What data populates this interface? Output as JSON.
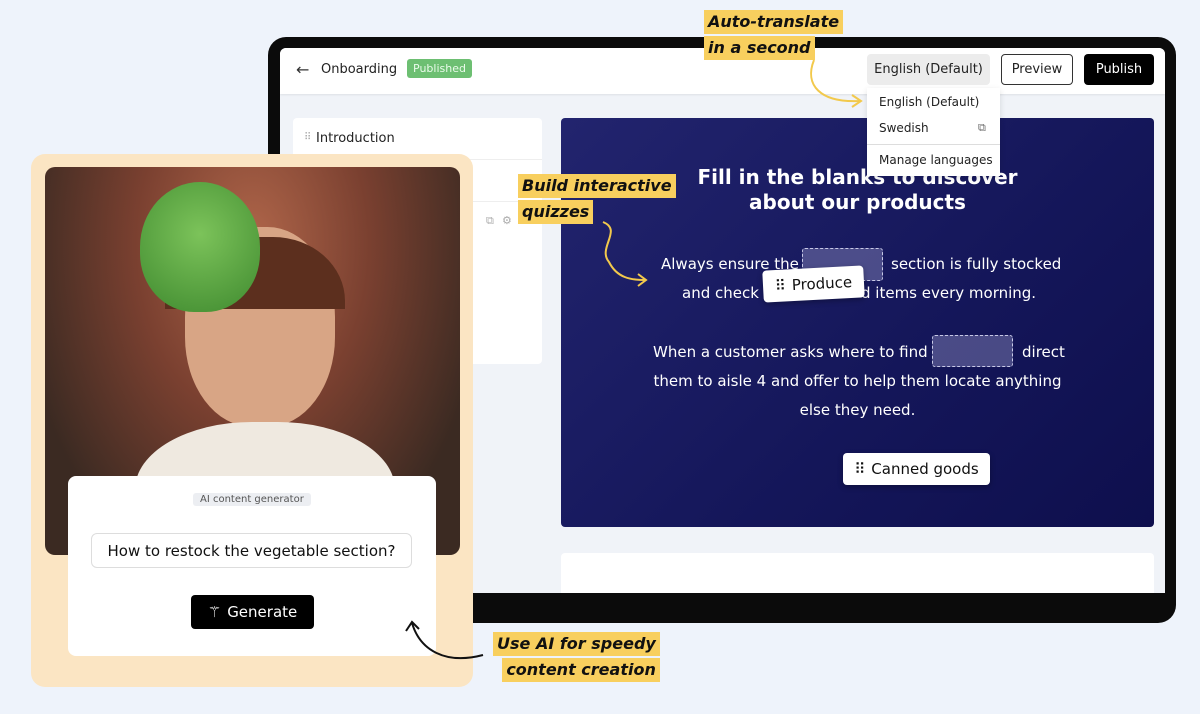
{
  "header": {
    "back_icon": "arrow-left-icon",
    "title": "Onboarding",
    "status": "Published",
    "language": "English (Default)",
    "preview": "Preview",
    "publish": "Publish"
  },
  "language_menu": {
    "items": [
      "English (Default)",
      "Swedish",
      "Manage languages"
    ],
    "translate_icon": "translate-icon"
  },
  "sidebar": {
    "items": [
      "Introduction"
    ]
  },
  "quiz": {
    "title_line1": "Fill in the blanks to discover",
    "title_line2": "about our products",
    "s1a": "Always ensure the",
    "s1b": "section is fully stocked",
    "s1c": "and check",
    "s1d": "d items every morning.",
    "s2a": "When a customer asks where to find",
    "s2b": "direct",
    "s2c": "them to aisle 4 and offer to help them locate anything",
    "s2d": "else they need.",
    "drag_chip": "Produce",
    "option": "Canned goods"
  },
  "annotations": {
    "translate_1": "Auto-translate",
    "translate_2": "in a second",
    "quiz_1": "Build interactive",
    "quiz_2": "quizzes",
    "ai_1": "Use AI for speedy",
    "ai_2": "content creation"
  },
  "ai_generator": {
    "badge": "AI content generator",
    "prompt": "How to restock the vegetable section?",
    "button": "Generate"
  },
  "colors": {
    "accent_yellow": "#f8cf5e",
    "quiz_bg": "#16185c",
    "published": "#6dbf72",
    "peach": "#fbe5c3"
  }
}
